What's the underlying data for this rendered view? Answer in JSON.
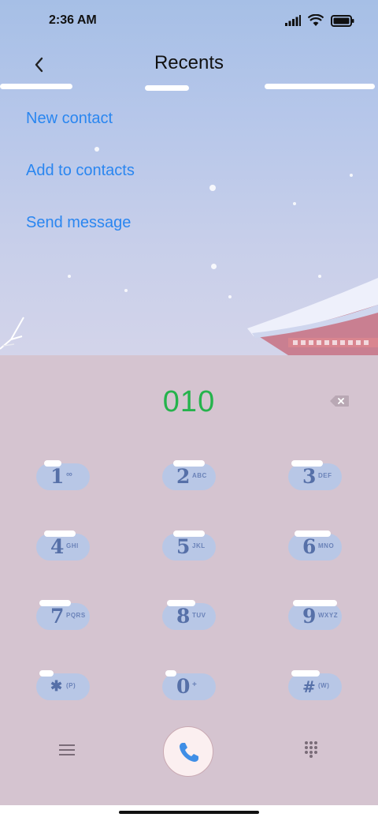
{
  "status": {
    "time": "2:36 AM"
  },
  "header": {
    "title": "Recents"
  },
  "menu": {
    "items": [
      {
        "label": "New contact"
      },
      {
        "label": "Add to contacts"
      },
      {
        "label": "Send message"
      }
    ]
  },
  "dialer": {
    "number": "010",
    "keys": [
      {
        "digit": "1",
        "sub": "∞"
      },
      {
        "digit": "2",
        "sub": "ABC"
      },
      {
        "digit": "3",
        "sub": "DEF"
      },
      {
        "digit": "4",
        "sub": "GHI"
      },
      {
        "digit": "5",
        "sub": "JKL"
      },
      {
        "digit": "6",
        "sub": "MNO"
      },
      {
        "digit": "7",
        "sub": "PQRS"
      },
      {
        "digit": "8",
        "sub": "TUV"
      },
      {
        "digit": "9",
        "sub": "WXYZ"
      },
      {
        "digit": "✱",
        "sub": "(P)"
      },
      {
        "digit": "0",
        "sub": "+"
      },
      {
        "digit": "#",
        "sub": "(W)"
      }
    ]
  },
  "colors": {
    "accent_link": "#2a86f0",
    "number_text": "#25b34c",
    "key_bg": "#b8c7e6",
    "dial_bg": "#d5c4d0"
  },
  "icons": {
    "back": "chevron-left-icon",
    "backspace": "backspace-icon",
    "menu": "menu-icon",
    "call": "phone-icon",
    "keypad": "keypad-icon"
  }
}
